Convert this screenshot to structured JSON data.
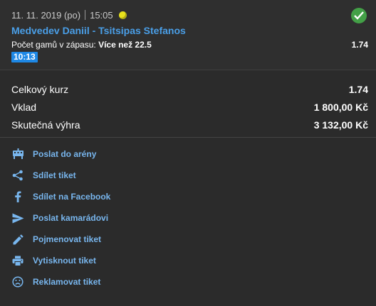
{
  "bet": {
    "date": "11. 11. 2019 (po)",
    "time": "15:05",
    "match": "Medvedev Daniil - Tsitsipas Stefanos",
    "market_label": "Počet gamů v zápasu:",
    "market_pick": "Více než 22.5",
    "odd": "1.74",
    "time_badge": "10:13",
    "status_icon": "check-circle-icon",
    "status_color": "#43a047"
  },
  "summary": {
    "total_odds_label": "Celkový kurz",
    "total_odds_value": "1.74",
    "stake_label": "Vklad",
    "stake_value": "1 800,00 Kč",
    "win_label": "Skutečná výhra",
    "win_value": "3 132,00 Kč"
  },
  "actions": [
    {
      "label": "Poslat do arény",
      "icon": "arena-icon"
    },
    {
      "label": "Sdílet tiket",
      "icon": "share-icon"
    },
    {
      "label": "Sdílet na Facebook",
      "icon": "facebook-icon"
    },
    {
      "label": "Poslat kamarádovi",
      "icon": "send-icon"
    },
    {
      "label": "Pojmenovat tiket",
      "icon": "pencil-icon"
    },
    {
      "label": "Vytisknout tiket",
      "icon": "print-icon"
    },
    {
      "label": "Reklamovat tiket",
      "icon": "complaint-icon"
    }
  ],
  "colors": {
    "accent": "#4a9fe8",
    "badge": "#1e88e5",
    "background": "#2b2b2b"
  }
}
